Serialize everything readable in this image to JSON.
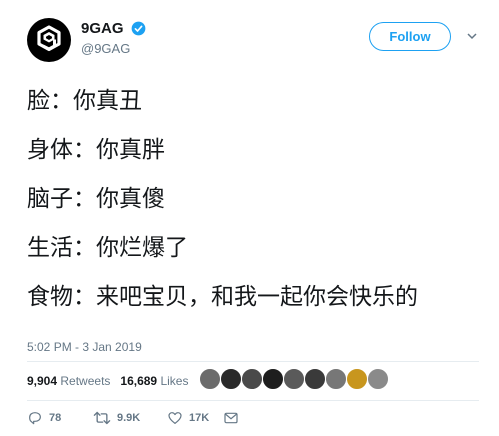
{
  "user": {
    "display_name": "9GAG",
    "handle": "@9GAG",
    "verified": true,
    "avatar_icon": "9gag-logo-icon"
  },
  "follow_button": {
    "label": "Follow"
  },
  "tweet": {
    "lines": [
      "脸：你真丑",
      "身体：你真胖",
      "脑子：你真傻",
      "生活：你烂爆了",
      "食物：来吧宝贝，和我一起你会快乐的"
    ]
  },
  "timestamp": "5:02 PM - 3 Jan 2019",
  "stats": {
    "retweets_count": "9,904",
    "retweets_label": "Retweets",
    "likes_count": "16,689",
    "likes_label": "Likes"
  },
  "liker_avatars": [
    {
      "color": "#6b6b6b"
    },
    {
      "color": "#2a2a2a"
    },
    {
      "color": "#4a4a4a"
    },
    {
      "color": "#1e1e1e"
    },
    {
      "color": "#5a5a5a"
    },
    {
      "color": "#3a3a3a"
    },
    {
      "color": "#777777"
    },
    {
      "color": "#c8961e"
    },
    {
      "color": "#8a8a8a"
    }
  ],
  "actions": {
    "reply_count": "78",
    "retweet_count": "9.9K",
    "like_count": "17K"
  },
  "colors": {
    "accent": "#1da1f2",
    "muted": "#657786",
    "text": "#14171a"
  }
}
